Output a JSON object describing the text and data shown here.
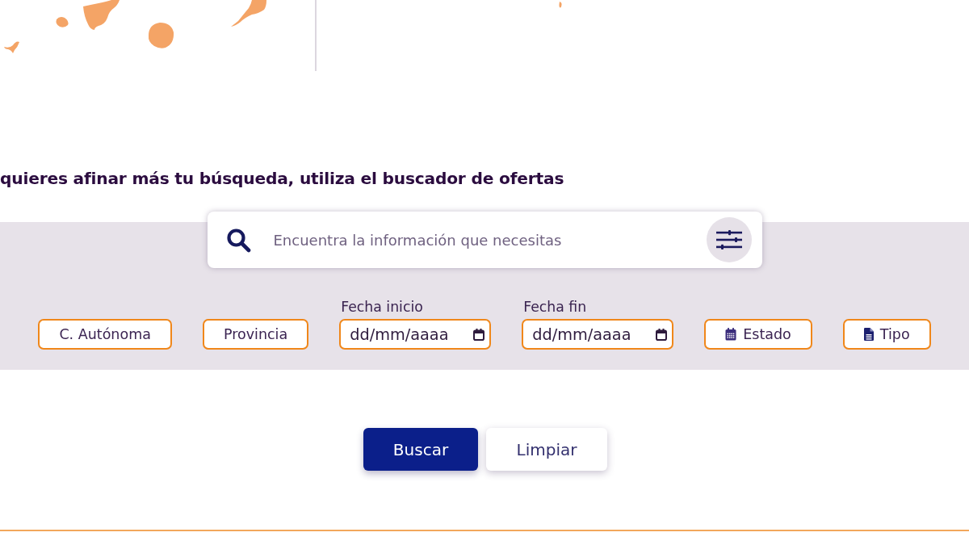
{
  "heading": "quieres afinar más tu búsqueda, utiliza el buscador de ofertas",
  "search": {
    "placeholder": "Encuentra la información que necesitas"
  },
  "filters": [
    {
      "kind": "select",
      "label": "C. Autónoma"
    },
    {
      "kind": "select",
      "label": "Provincia"
    },
    {
      "kind": "date",
      "caption": "Fecha inicio",
      "placeholder": "dd/mm/aaaa"
    },
    {
      "kind": "date",
      "caption": "Fecha fin",
      "placeholder": "dd/mm/aaaa"
    },
    {
      "kind": "status",
      "label": "Estado"
    },
    {
      "kind": "category",
      "label": "Tipo"
    }
  ],
  "buttons": [
    {
      "kind": "primary",
      "label": "Buscar"
    },
    {
      "kind": "secondary",
      "label": "Limpiar"
    }
  ]
}
